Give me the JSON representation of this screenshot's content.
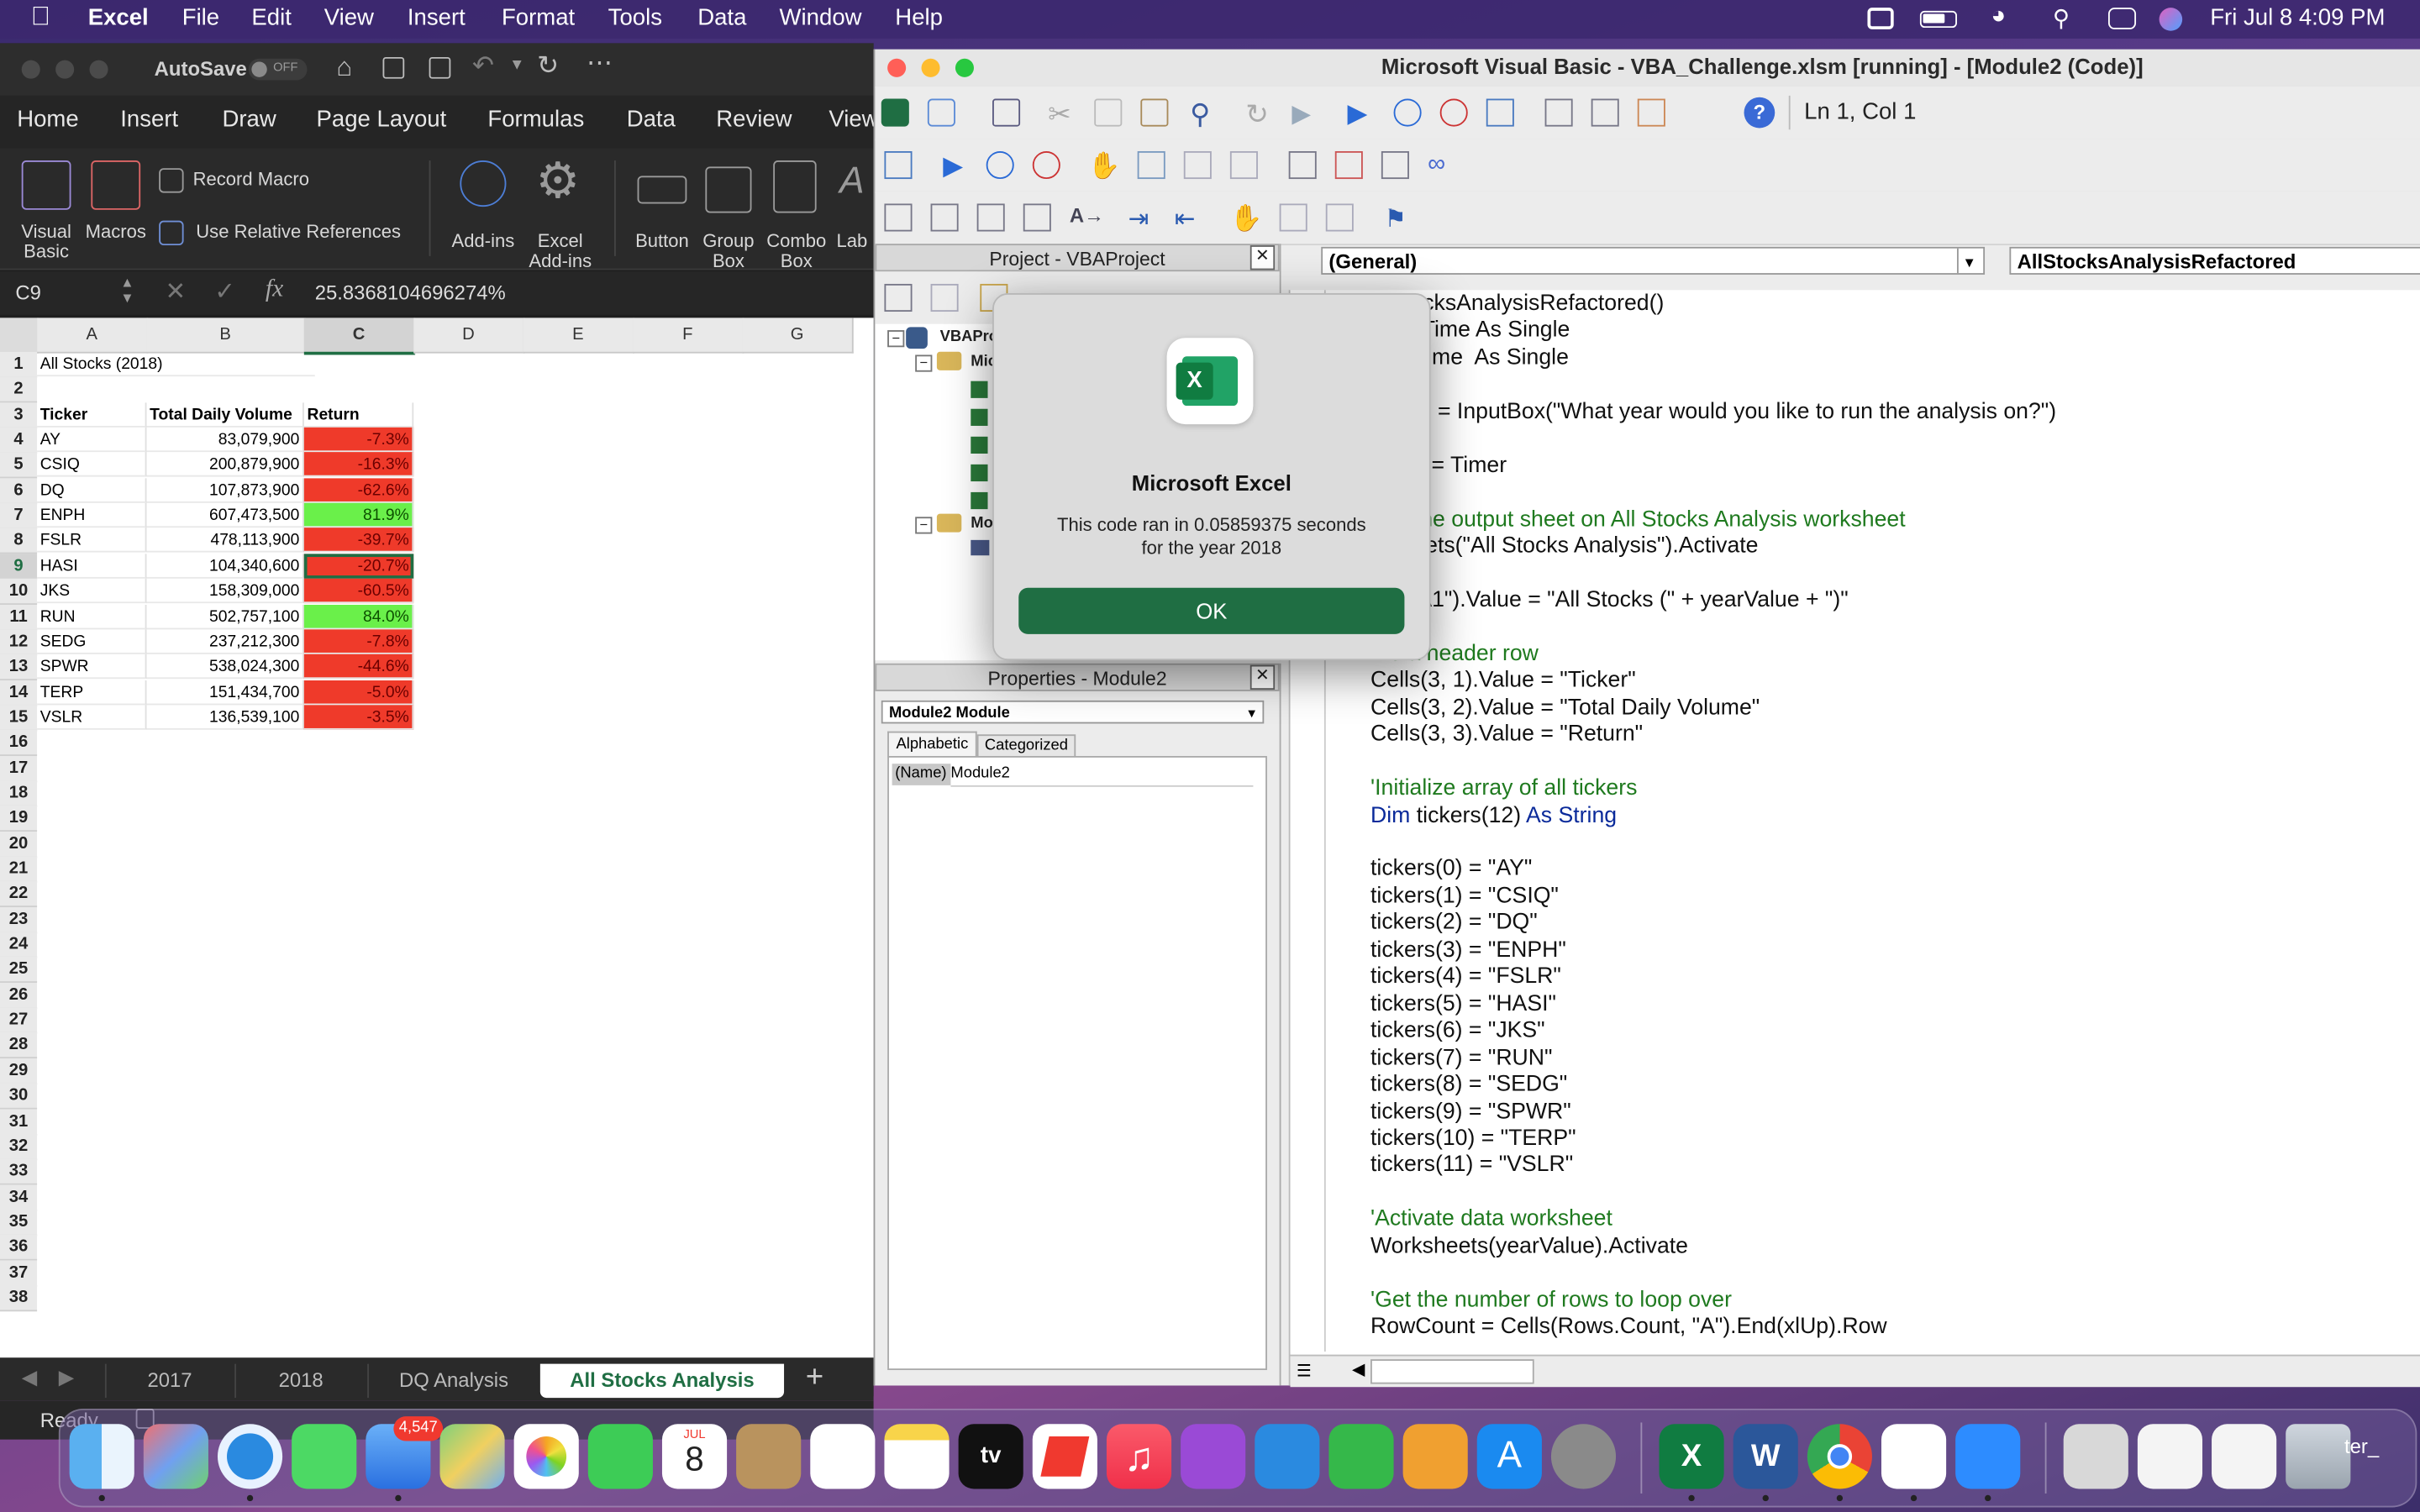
{
  "menubar": {
    "app": "Excel",
    "items": [
      "File",
      "Edit",
      "View",
      "Insert",
      "Format",
      "Tools",
      "Data",
      "Window",
      "Help"
    ],
    "clock": "Fri Jul 8  4:09 PM"
  },
  "excel": {
    "autosave_label": "AutoSave",
    "autosave_state": "OFF",
    "ribbon_tabs": [
      "Home",
      "Insert",
      "Draw",
      "Page Layout",
      "Formulas",
      "Data",
      "Review",
      "View"
    ],
    "ribbon_buttons": {
      "visual_basic": "Visual Basic",
      "macros": "Macros",
      "record_macro": "Record Macro",
      "use_relative": "Use Relative References",
      "addins": "Add-ins",
      "excel_addins": "Excel Add-ins",
      "button": "Button",
      "group_box": "Group Box",
      "combo_box": "Combo Box",
      "label": "Lab"
    },
    "name_box": "C9",
    "formula": "25.8368104696274%",
    "columns": [
      "A",
      "B",
      "C",
      "D",
      "E",
      "F",
      "G"
    ],
    "title_cell": "All Stocks (2018)",
    "headers": [
      "Ticker",
      "Total Daily Volume",
      "Return"
    ],
    "rows": [
      {
        "ticker": "AY",
        "volume": "83,079,900",
        "ret": "-7.3%",
        "positive": false
      },
      {
        "ticker": "CSIQ",
        "volume": "200,879,900",
        "ret": "-16.3%",
        "positive": false
      },
      {
        "ticker": "DQ",
        "volume": "107,873,900",
        "ret": "-62.6%",
        "positive": false
      },
      {
        "ticker": "ENPH",
        "volume": "607,473,500",
        "ret": "81.9%",
        "positive": true
      },
      {
        "ticker": "FSLR",
        "volume": "478,113,900",
        "ret": "-39.7%",
        "positive": false
      },
      {
        "ticker": "HASI",
        "volume": "104,340,600",
        "ret": "-20.7%",
        "positive": false
      },
      {
        "ticker": "JKS",
        "volume": "158,309,000",
        "ret": "-60.5%",
        "positive": false
      },
      {
        "ticker": "RUN",
        "volume": "502,757,100",
        "ret": "84.0%",
        "positive": true
      },
      {
        "ticker": "SEDG",
        "volume": "237,212,300",
        "ret": "-7.8%",
        "positive": false
      },
      {
        "ticker": "SPWR",
        "volume": "538,024,300",
        "ret": "-44.6%",
        "positive": false
      },
      {
        "ticker": "TERP",
        "volume": "151,434,700",
        "ret": "-5.0%",
        "positive": false
      },
      {
        "ticker": "VSLR",
        "volume": "136,539,100",
        "ret": "-3.5%",
        "positive": false
      }
    ],
    "sheet_tabs": [
      "2017",
      "2018",
      "DQ Analysis",
      "All Stocks Analysis"
    ],
    "active_sheet": "All Stocks Analysis",
    "add_sheet": "+",
    "status": "Ready"
  },
  "vba": {
    "title": "Microsoft Visual Basic - VBA_Challenge.xlsm [running] - [Module2 (Code)]",
    "cursor_pos": "Ln 1, Col 1",
    "project_title": "Project - VBAProject",
    "project_root": "VBAPro",
    "project_node1": "Mic",
    "project_node2": "Mo",
    "properties_title": "Properties - Module2",
    "properties_combo": "Module2  Module",
    "prop_tabs": [
      "Alphabetic",
      "Categorized"
    ],
    "prop_name_key": "(Name)",
    "prop_name_val": "Module2",
    "general_combo": "(General)",
    "proc_combo": "AllStocksAnalysisRefactored",
    "code_lines": [
      {
        "t": "...StocksAnalysisRefactored()",
        "c": "n"
      },
      {
        "t": "...tartTime As Single",
        "c": "n"
      },
      {
        "t": "...ndTime  As Single",
        "c": "n"
      },
      {
        "t": "",
        "c": "n"
      },
      {
        "t": "...alue = InputBox(\"What year would you like to run the analysis on?\")",
        "c": "n"
      },
      {
        "t": "",
        "c": "n"
      },
      {
        "t": "...ime = Timer",
        "c": "n"
      },
      {
        "t": "",
        "c": "n"
      },
      {
        "t": "...at the output sheet on All Stocks Analysis worksheet",
        "c": "c"
      },
      {
        "t": "...sheets(\"All Stocks Analysis\").Activate",
        "c": "n"
      },
      {
        "t": "",
        "c": "n"
      },
      {
        "t": "...e(\"A1\").Value = \"All Stocks (\" + yearValue + \")\"",
        "c": "n"
      },
      {
        "t": "",
        "c": "n"
      },
      {
        "t": "...e a header row",
        "c": "c"
      },
      {
        "t": "Cells(3, 1).Value = \"Ticker\"",
        "c": "n"
      },
      {
        "t": "Cells(3, 2).Value = \"Total Daily Volume\"",
        "c": "n"
      },
      {
        "t": "Cells(3, 3).Value = \"Return\"",
        "c": "n"
      },
      {
        "t": "",
        "c": "n"
      },
      {
        "t": "'Initialize array of all tickers",
        "c": "c"
      },
      {
        "t": "Dim tickers(12) As String",
        "c": "k"
      },
      {
        "t": "",
        "c": "n"
      },
      {
        "t": "tickers(0) = \"AY\"",
        "c": "n"
      },
      {
        "t": "tickers(1) = \"CSIQ\"",
        "c": "n"
      },
      {
        "t": "tickers(2) = \"DQ\"",
        "c": "n"
      },
      {
        "t": "tickers(3) = \"ENPH\"",
        "c": "n"
      },
      {
        "t": "tickers(4) = \"FSLR\"",
        "c": "n"
      },
      {
        "t": "tickers(5) = \"HASI\"",
        "c": "n"
      },
      {
        "t": "tickers(6) = \"JKS\"",
        "c": "n"
      },
      {
        "t": "tickers(7) = \"RUN\"",
        "c": "n"
      },
      {
        "t": "tickers(8) = \"SEDG\"",
        "c": "n"
      },
      {
        "t": "tickers(9) = \"SPWR\"",
        "c": "n"
      },
      {
        "t": "tickers(10) = \"TERP\"",
        "c": "n"
      },
      {
        "t": "tickers(11) = \"VSLR\"",
        "c": "n"
      },
      {
        "t": "",
        "c": "n"
      },
      {
        "t": "'Activate data worksheet",
        "c": "c"
      },
      {
        "t": "Worksheets(yearValue).Activate",
        "c": "n"
      },
      {
        "t": "",
        "c": "n"
      },
      {
        "t": "'Get the number of rows to loop over",
        "c": "c"
      },
      {
        "t": "RowCount = Cells(Rows.Count, \"A\").End(xlUp).Row",
        "c": "n"
      }
    ]
  },
  "dialog": {
    "title": "Microsoft Excel",
    "message_line1": "This code ran in 0.05859375 seconds",
    "message_line2": "for the year 2018",
    "ok": "OK"
  },
  "dock": {
    "mail_badge": "4,547",
    "cal_month": "JUL",
    "cal_day": "8",
    "tv_label": "tv",
    "trash_label": "ter_"
  },
  "colors": {
    "excel_green": "#1f6e43",
    "negative": "#ef3a2a",
    "positive": "#6af04a",
    "vba_comment": "#1f7a1f",
    "vba_keyword": "#0a2a9a"
  }
}
